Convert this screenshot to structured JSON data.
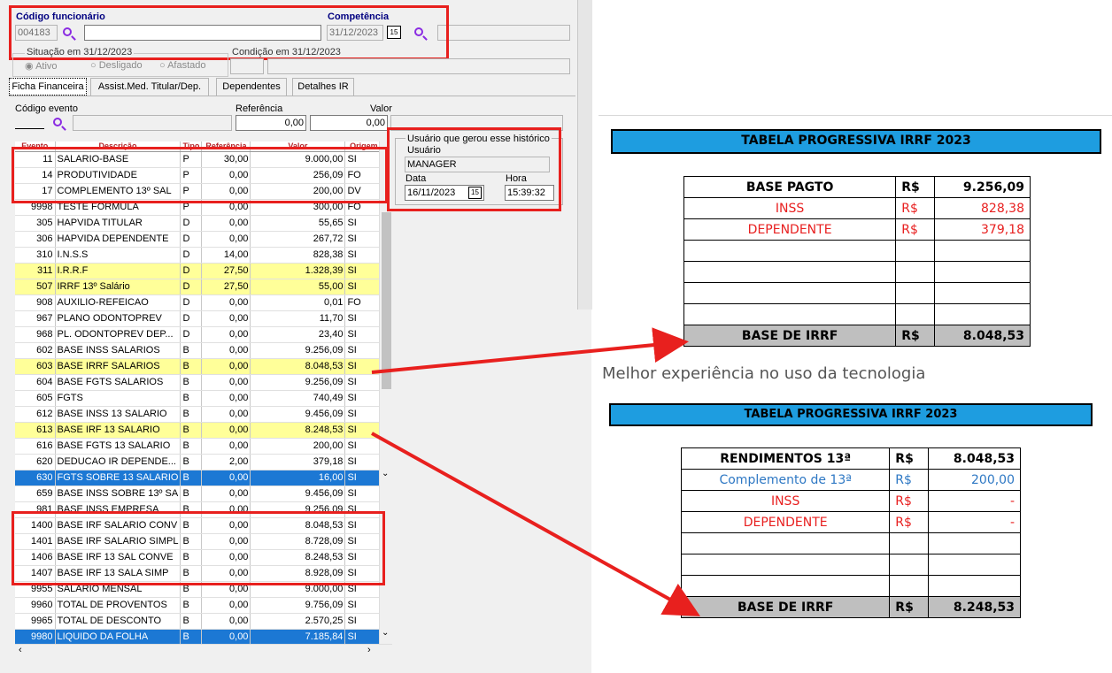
{
  "form": {
    "codigo_label": "Código funcionário",
    "codigo_value": "004183",
    "competencia_label": "Competência",
    "competencia_value": "31/12/2023",
    "situacao_label": "Situação em  31/12/2023",
    "condicao_label": "Condição em 31/12/2023",
    "situacao_options": [
      "Ativo",
      "Desligado",
      "Afastado"
    ]
  },
  "tabs": [
    "Ficha Financeira",
    "Assist.Med. Titular/Dep.",
    "Dependentes",
    "Detalhes IR"
  ],
  "event_filter": {
    "codigo_label": "Código evento",
    "referencia_label": "Referência",
    "valor_label": "Valor",
    "referencia_value": "0,00",
    "valor_value": "0,00"
  },
  "grid": {
    "columns": [
      "Evento",
      "Descrição",
      "Tipo",
      "Referência",
      "Valor",
      "Origem"
    ],
    "rows": [
      [
        "11",
        "SALARIO-BASE",
        "P",
        "30,00",
        "9.000,00",
        "SI",
        "white"
      ],
      [
        "14",
        "PRODUTIVIDADE",
        "P",
        "0,00",
        "256,09",
        "FO",
        "white"
      ],
      [
        "17",
        "COMPLEMENTO 13º SAL",
        "P",
        "0,00",
        "200,00",
        "DV",
        "white"
      ],
      [
        "9998",
        "TESTE FORMULA",
        "P",
        "0,00",
        "300,00",
        "FO",
        "white"
      ],
      [
        "305",
        "HAPVIDA TITULAR",
        "D",
        "0,00",
        "55,65",
        "SI",
        "white"
      ],
      [
        "306",
        "HAPVIDA DEPENDENTE",
        "D",
        "0,00",
        "267,72",
        "SI",
        "white"
      ],
      [
        "310",
        "I.N.S.S",
        "D",
        "14,00",
        "828,38",
        "SI",
        "white"
      ],
      [
        "311",
        "I.R.R.F",
        "D",
        "27,50",
        "1.328,39",
        "SI",
        "yellow"
      ],
      [
        "507",
        "IRRF 13º Salário",
        "D",
        "27,50",
        "55,00",
        "SI",
        "yellow"
      ],
      [
        "908",
        "AUXILIO-REFEICAO",
        "D",
        "0,00",
        "0,01",
        "FO",
        "white"
      ],
      [
        "967",
        "PLANO ODONTOPREV",
        "D",
        "0,00",
        "11,70",
        "SI",
        "white"
      ],
      [
        "968",
        "PL. ODONTOPREV DEP...",
        "D",
        "0,00",
        "23,40",
        "SI",
        "white"
      ],
      [
        "602",
        "BASE INSS SALARIOS",
        "B",
        "0,00",
        "9.256,09",
        "SI",
        "white"
      ],
      [
        "603",
        "BASE IRRF SALARIOS",
        "B",
        "0,00",
        "8.048,53",
        "SI",
        "yellow"
      ],
      [
        "604",
        "BASE FGTS SALARIOS",
        "B",
        "0,00",
        "9.256,09",
        "SI",
        "white"
      ],
      [
        "605",
        "FGTS",
        "B",
        "0,00",
        "740,49",
        "SI",
        "white"
      ],
      [
        "612",
        "BASE INSS 13 SALARIO",
        "B",
        "0,00",
        "9.456,09",
        "SI",
        "white"
      ],
      [
        "613",
        "BASE IRF 13 SALARIO",
        "B",
        "0,00",
        "8.248,53",
        "SI",
        "yellow"
      ],
      [
        "616",
        "BASE FGTS 13 SALARIO",
        "B",
        "0,00",
        "200,00",
        "SI",
        "white"
      ],
      [
        "620",
        "DEDUCAO IR DEPENDE...",
        "B",
        "2,00",
        "379,18",
        "SI",
        "white"
      ],
      [
        "630",
        "FGTS SOBRE 13 SALARIO",
        "B",
        "0,00",
        "16,00",
        "SI",
        "sel"
      ],
      [
        "659",
        "BASE INSS SOBRE 13º SA",
        "B",
        "0,00",
        "9.456,09",
        "SI",
        "white"
      ],
      [
        "981",
        "BASE INSS EMPRESA",
        "B",
        "0,00",
        "9.256,09",
        "SI",
        "white"
      ],
      [
        "1400",
        "BASE IRF  SALARIO CONV",
        "B",
        "0,00",
        "8.048,53",
        "SI",
        "white"
      ],
      [
        "1401",
        "BASE IRF SALARIO SIMPL",
        "B",
        "0,00",
        "8.728,09",
        "SI",
        "white"
      ],
      [
        "1406",
        "BASE IRF  13 SAL CONVE",
        "B",
        "0,00",
        "8.248,53",
        "SI",
        "white"
      ],
      [
        "1407",
        "BASE IRF  13 SALA SIMP",
        "B",
        "0,00",
        "8.928,09",
        "SI",
        "white"
      ],
      [
        "9955",
        "SALARIO MENSAL",
        "B",
        "0,00",
        "9.000,00",
        "SI",
        "white"
      ],
      [
        "9960",
        "TOTAL DE PROVENTOS",
        "B",
        "0,00",
        "9.756,09",
        "SI",
        "white"
      ],
      [
        "9965",
        "TOTAL DE DESCONTO",
        "B",
        "0,00",
        "2.570,25",
        "SI",
        "white"
      ],
      [
        "9980",
        "LIQUIDO DA FOLHA",
        "B",
        "0,00",
        "7.185,84",
        "SI",
        "sel"
      ]
    ]
  },
  "historico": {
    "title": "Usuário que gerou esse histórico",
    "usuario_label": "Usuário",
    "usuario_value": "MANAGER",
    "data_label": "Data",
    "data_value": "16/11/2023",
    "hora_label": "Hora",
    "hora_value": "15:39:32"
  },
  "excel1": {
    "title": "TABELA PROGRESSIVA IRRF 2023",
    "rows": [
      {
        "label": "BASE PAGTO",
        "cur": "R$",
        "val": "9.256,09",
        "style": "bold"
      },
      {
        "label": "INSS",
        "cur": "R$",
        "val": "828,38",
        "style": "red"
      },
      {
        "label": "DEPENDENTE",
        "cur": "R$",
        "val": "379,18",
        "style": "red"
      }
    ],
    "total_label": "BASE DE IRRF",
    "total_cur": "R$",
    "total_val": "8.048,53"
  },
  "caption": "Melhor experiência no uso da tecnologia",
  "excel2": {
    "title": "TABELA PROGRESSIVA IRRF 2023",
    "rows": [
      {
        "label": "RENDIMENTOS 13ª",
        "cur": "R$",
        "val": "8.048,53",
        "style": "bold"
      },
      {
        "label": "Complemento de 13ª",
        "cur": "R$",
        "val": "200,00",
        "style": "blue"
      },
      {
        "label": "INSS",
        "cur": "R$",
        "val": "-",
        "style": "red"
      },
      {
        "label": "DEPENDENTE",
        "cur": "R$",
        "val": "-",
        "style": "red"
      }
    ],
    "total_label": "BASE DE IRRF",
    "total_cur": "R$",
    "total_val": "8.248,53"
  },
  "colors": {
    "accent": "#1c78d4",
    "highlight": "#ffff99",
    "callout": "#e8201e",
    "excel_header": "#1e9de0"
  }
}
